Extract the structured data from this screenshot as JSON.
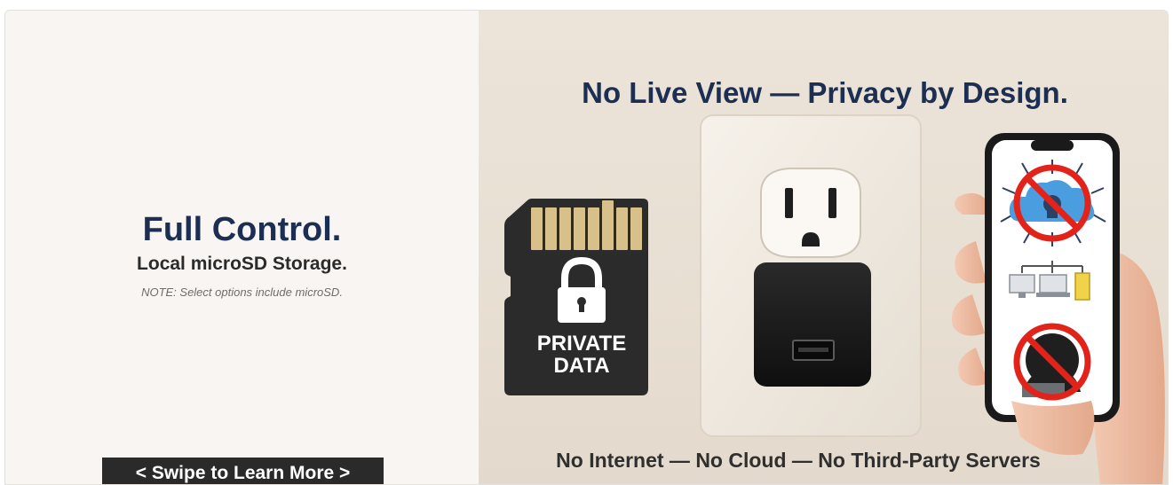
{
  "left": {
    "title": "Full Control.",
    "subtitle": "Local microSD Storage.",
    "note": "NOTE: Select options include microSD.",
    "swipe_label": "< Swipe to Learn More >"
  },
  "right": {
    "title": "No Live View — Privacy by Design.",
    "footer": "No Internet — No Cloud — No Third-Party Servers",
    "card_text_line1": "PRIVATE",
    "card_text_line2": "DATA"
  },
  "colors": {
    "heading": "#1c2f52",
    "prohibition_red": "#e2231a",
    "card_dark": "#2b2b2b",
    "contacts_gold": "#d8c08a"
  },
  "icons": [
    "microsd-card-icon",
    "padlock-icon",
    "wall-outlet-icon",
    "usb-charger-icon",
    "smartphone-icon",
    "no-cloud-hacker-icon",
    "network-devices-icon",
    "no-hacker-icon"
  ]
}
